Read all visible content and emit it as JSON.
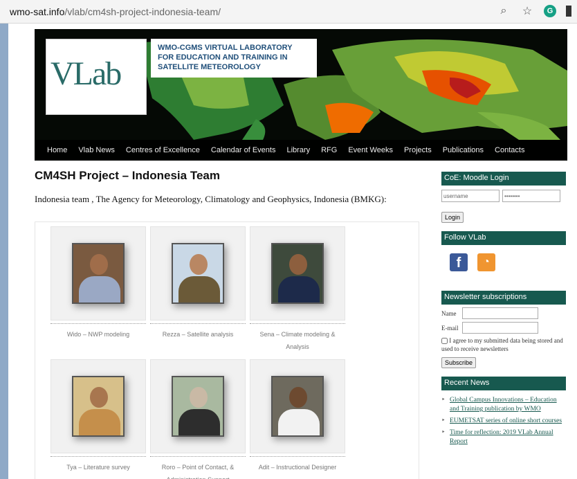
{
  "browser": {
    "url_host": "wmo-sat.info",
    "url_path": "/vlab/cm4sh-project-indonesia-team/",
    "icons": [
      "zoom-icon",
      "star-icon",
      "grammarly-icon",
      "extension-icon"
    ]
  },
  "header": {
    "logo_text": "VLab",
    "tagline": [
      "WMO-CGMS VIRTUAL LABORATORY",
      "FOR EDUCATION AND TRAINING IN",
      "SATELLITE METEOROLOGY"
    ],
    "nav": [
      "Home",
      "Vlab News",
      "Centres of Excellence",
      "Calendar of Events",
      "Library",
      "RFG",
      "Event Weeks",
      "Projects",
      "Publications",
      "Contacts"
    ]
  },
  "main": {
    "title": "CM4SH Project – Indonesia Team",
    "subtitle": "Indonesia team , The Agency for Meteorology, Climatology and Geophysics, Indonesia (BMKG):",
    "team": [
      {
        "caption": "Wido – NWP modeling"
      },
      {
        "caption": "Rezza – Satellite analysis"
      },
      {
        "caption": "Sena – Climate modeling & Analysis"
      },
      {
        "caption": "Tya – Literature survey"
      },
      {
        "caption": "Roro – Point of Contact, & Administration Support"
      },
      {
        "caption": "Adit – Instructional Designer"
      }
    ]
  },
  "sidebar": {
    "login": {
      "heading": "CoE: Moodle Login",
      "username_value": "username",
      "password_value": "••••••••",
      "button": "Login"
    },
    "follow": {
      "heading": "Follow VLab"
    },
    "newsletter": {
      "heading": "Newsletter subscriptions",
      "name_label": "Name",
      "email_label": "E-mail",
      "consent": "I agree to my submitted data being stored and used to receive newsletters",
      "button": "Subscribe"
    },
    "recent_news": {
      "heading": "Recent News",
      "items": [
        "Global Campus Innovations – Education and Training publication by WMO",
        "EUMETSAT series of online short courses",
        "Time for reflection: 2019 VLab Annual Report"
      ]
    }
  },
  "colors": {
    "brand": "#17594f",
    "nav_bg": "#000000"
  }
}
